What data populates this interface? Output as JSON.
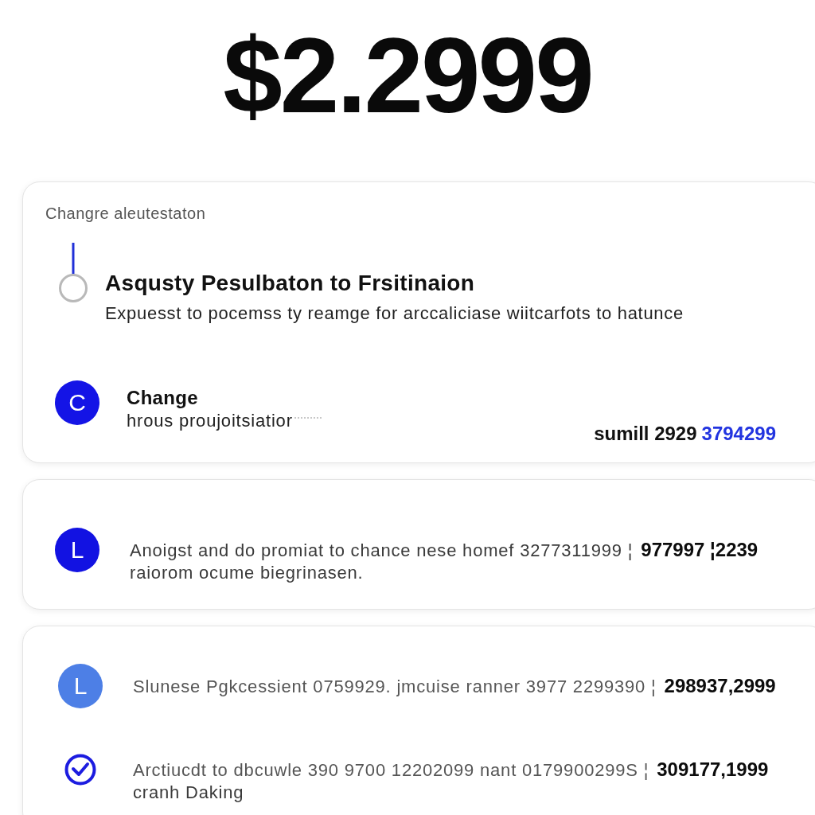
{
  "amount": "$2.2999",
  "summary_card": {
    "caption": "Changre aleutestaton",
    "step": {
      "title": "Asqusty Pesulbaton to Frsitinaion",
      "description": "Expuesst to pocemss ty reamge for arccaliciase wiitcarfots to hatunce"
    },
    "entry": {
      "badge": {
        "kind": "letter",
        "letter": "C",
        "color": "#1414e6"
      },
      "title": "Change",
      "subtitle": "hrous proujoitsiatior",
      "total_label": "sumill 2929",
      "total_value": "3794299"
    }
  },
  "activity_cards": [
    {
      "items": [
        {
          "badge": {
            "kind": "letter",
            "letter": "L",
            "color": "#1212e2"
          },
          "text": "Anoigst and do promiat to chance nese homef 3277311999 ¦",
          "amount": "977997 ¦2239",
          "note": "raiorom ocume biegrinasen."
        }
      ]
    },
    {
      "items": [
        {
          "badge": {
            "kind": "letter",
            "letter": "L",
            "color": "#4d7fe6"
          },
          "text": "Slunese Pgkcessient 0759929. jmcuise ranner 3977 2299390 ¦",
          "amount": "298937,2999"
        },
        {
          "badge": {
            "kind": "check",
            "color": "#1c1ce0"
          },
          "text": "Arctiucdt to dbcuwle 390 9700 12202099 nant 0179900299S ¦",
          "amount": "309177,1999",
          "note": "cranh Daking"
        }
      ]
    }
  ]
}
